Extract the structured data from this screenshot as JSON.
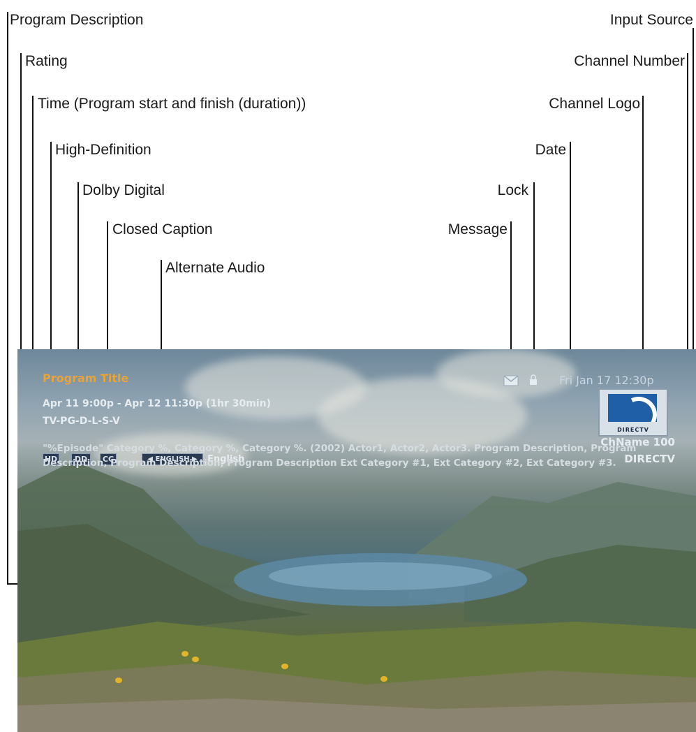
{
  "callouts": {
    "program_description": "Program Description",
    "rating": "Rating",
    "time": "Time (Program start and finish (duration))",
    "high_definition": "High-Definition",
    "dolby_digital": "Dolby Digital",
    "closed_caption": "Closed Caption",
    "alternate_audio": "Alternate Audio",
    "input_source": "Input Source",
    "channel_number": "Channel Number",
    "channel_logo": "Channel Logo",
    "date": "Date",
    "lock": "Lock",
    "message": "Message"
  },
  "screen": {
    "program_title": "Program Title",
    "time": "Apr 11 9:00p - Apr 12 11:30p (1hr 30min)",
    "rating": "TV-PG-D-L-S-V",
    "hd_badge": "HD",
    "dolby_badge": "DD",
    "cc_badge": "CC",
    "audio_badge": "◀ ENGLISH ▶",
    "audio_language": "English",
    "date": "Fri Jan 17 12:30p",
    "logo_text": "DIRECTV",
    "channel": "ChName 100",
    "input_source": "DIRECTV",
    "description": "\"%Episode\" Category %, Category %, Category %. (2002) Actor1, Actor2, Actor3. Program Description, Program Description, Program Description, Program Description Ext Category #1, Ext Category #2, Ext Category #3."
  },
  "colors": {
    "title": "#e8a43c",
    "overlay_text": "#e6ecf0",
    "brand_blue": "#1f5fa8"
  },
  "icons": [
    "message-icon",
    "lock-icon",
    "hd-icon",
    "dolby-digital-icon",
    "closed-caption-icon",
    "channel-logo"
  ]
}
